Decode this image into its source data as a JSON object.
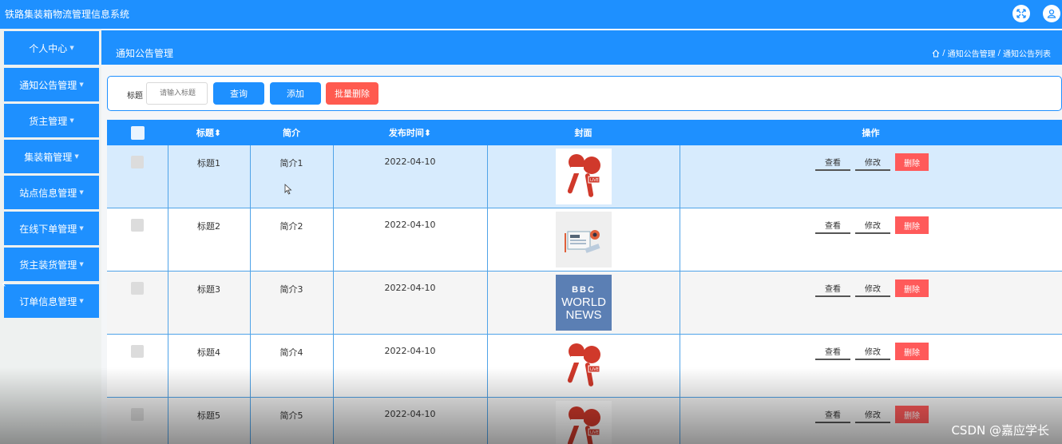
{
  "app": {
    "title": "铁路集装箱物流管理信息系统"
  },
  "sidebar": {
    "items": [
      {
        "label": "个人中心"
      },
      {
        "label": "通知公告管理"
      },
      {
        "label": "货主管理"
      },
      {
        "label": "集装箱管理"
      },
      {
        "label": "站点信息管理"
      },
      {
        "label": "在线下单管理"
      },
      {
        "label": "货主装货管理"
      },
      {
        "label": "订单信息管理"
      }
    ]
  },
  "header": {
    "page_title": "通知公告管理",
    "breadcrumb": [
      "通知公告管理",
      "通知公告列表"
    ]
  },
  "search": {
    "label": "标题",
    "placeholder": "请输入标题",
    "query_button": "查询",
    "add_button": "添加",
    "batch_delete_button": "批量删除"
  },
  "table": {
    "columns": [
      "标题",
      "简介",
      "发布时间",
      "封面",
      "操作"
    ],
    "rows": [
      {
        "title": "标题1",
        "intro": "简介1",
        "date": "2022-04-10",
        "cover": "microphone-live-icon"
      },
      {
        "title": "标题2",
        "intro": "简介2",
        "date": "2022-04-10",
        "cover": "newspaper-icon"
      },
      {
        "title": "标题3",
        "intro": "简介3",
        "date": "2022-04-10",
        "cover": "bbc-world-news-logo"
      },
      {
        "title": "标题4",
        "intro": "简介4",
        "date": "2022-04-10",
        "cover": "microphone-live-icon"
      },
      {
        "title": "标题5",
        "intro": "简介5",
        "date": "2022-04-10",
        "cover": "microphone-live-icon"
      }
    ],
    "actions": {
      "view": "查看",
      "edit": "修改",
      "delete": "删除"
    }
  },
  "bbc": {
    "line1": "BBC",
    "line2": "WORLD",
    "line3": "NEWS"
  },
  "watermark": "CSDN @嘉应学长",
  "colors": {
    "primary": "#1e90ff",
    "danger": "#ff5a4f",
    "selected_row": "#d7ebfd"
  }
}
